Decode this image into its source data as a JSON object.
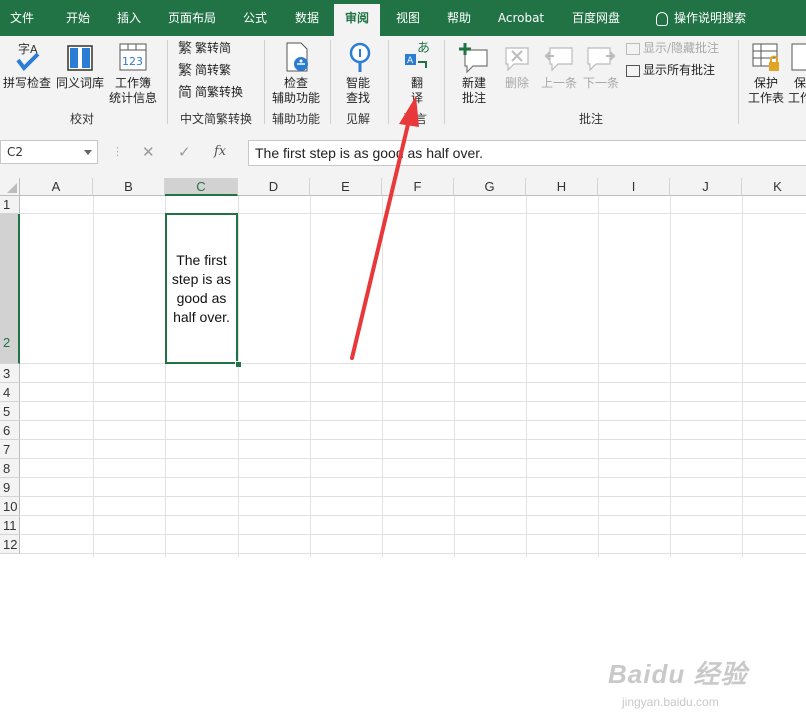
{
  "tabs": [
    {
      "label": "文件",
      "active": false
    },
    {
      "label": "开始",
      "active": false
    },
    {
      "label": "插入",
      "active": false
    },
    {
      "label": "页面布局",
      "active": false
    },
    {
      "label": "公式",
      "active": false
    },
    {
      "label": "数据",
      "active": false
    },
    {
      "label": "审阅",
      "active": true
    },
    {
      "label": "视图",
      "active": false
    },
    {
      "label": "帮助",
      "active": false
    },
    {
      "label": "Acrobat",
      "active": false
    },
    {
      "label": "百度网盘",
      "active": false
    }
  ],
  "tell_me": "操作说明搜索",
  "ribbon": {
    "proofing": {
      "spell": "拼写检查",
      "thesaurus": "同义词库",
      "stats_line1": "工作簿",
      "stats_line2": "统计信息",
      "group": "校对"
    },
    "chinese": {
      "to_trad": "繁转简",
      "to_simp": "简转繁",
      "convert": "简繁转换",
      "group": "中文简繁转换"
    },
    "accessibility": {
      "check_line1": "检查",
      "check_line2": "辅助功能",
      "group": "辅助功能"
    },
    "insights": {
      "smart_line1": "智能",
      "smart_line2": "查找",
      "group": "见解"
    },
    "language": {
      "translate_line1": "翻",
      "translate_line2": "译",
      "group": "语言"
    },
    "comments": {
      "new_line1": "新建",
      "new_line2": "批注",
      "delete": "删除",
      "prev": "上一条",
      "next": "下一条",
      "show_hide": "显示/隐藏批注",
      "show_all": "显示所有批注",
      "group": "批注"
    },
    "protect": {
      "sheet_line1": "保护",
      "sheet_line2": "工作表",
      "wb_line1": "保",
      "wb_line2": "工作"
    }
  },
  "formula_bar": {
    "name_box": "C2",
    "cancel": "✕",
    "enter": "✓",
    "fx": "fx",
    "content": "The first step is as good as half over."
  },
  "columns": [
    "A",
    "B",
    "C",
    "D",
    "E",
    "F",
    "G",
    "H",
    "I",
    "J",
    "K"
  ],
  "selected_column": "C",
  "rows": [
    "1",
    "2",
    "3",
    "4",
    "5",
    "6",
    "7",
    "8",
    "9",
    "10",
    "11",
    "12"
  ],
  "selected_row": "2",
  "cell_c2": "The first step is as good as half over.",
  "watermark": {
    "line1": "Baidu 经验",
    "line2": "jingyan.baidu.com"
  },
  "colors": {
    "brand": "#217346",
    "arrow": "#e8383a"
  }
}
